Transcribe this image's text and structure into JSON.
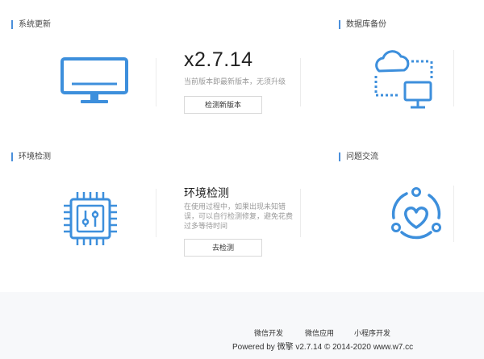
{
  "sections": {
    "update": {
      "title": "系统更新",
      "version": "x2.7.14",
      "description": "当前版本即最新版本，无须升级",
      "button_label": "检测新版本"
    },
    "backup": {
      "title": "数据库备份"
    },
    "env": {
      "title": "环境检测",
      "heading": "环境检测",
      "description": "在使用过程中，如果出现未知错误，可以自行检测修复，避免花费过多等待时间",
      "button_label": "去检测"
    },
    "issues": {
      "title": "问题交流"
    }
  },
  "footer": {
    "links": [
      "微信开发",
      "微信应用",
      "小程序开发"
    ],
    "copyright": "Powered by 微擎 v2.7.14 © 2014-2020 www.w7.cc"
  },
  "colors": {
    "accent": "#3d8fdc"
  },
  "icons": {
    "update": "monitor-icon",
    "backup": "cloud-sync-icon",
    "env": "chip-icon",
    "issues": "heart-cycle-icon"
  }
}
